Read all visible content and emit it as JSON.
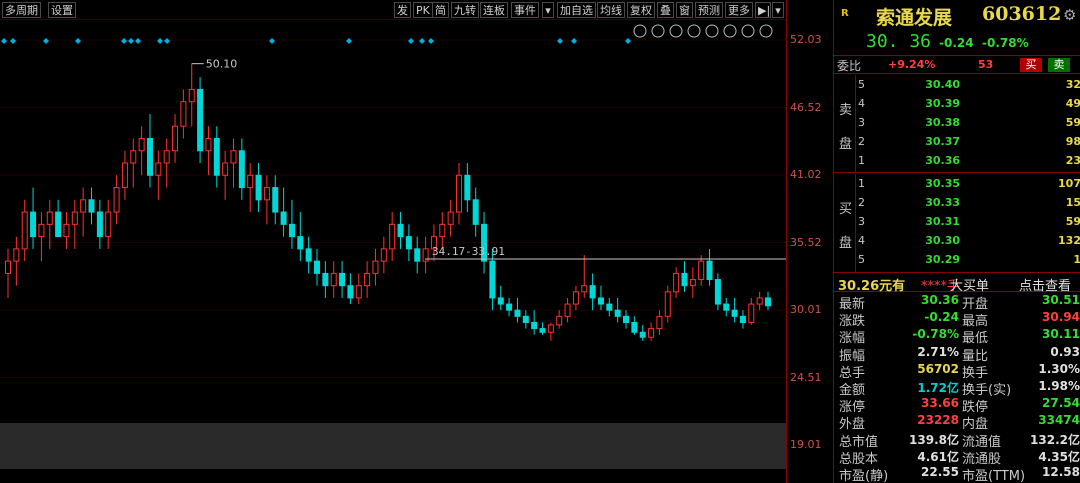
{
  "toolbar": {
    "left": [
      "多周期",
      "设置"
    ],
    "right": [
      "发",
      "PK",
      "简",
      "九转",
      "连板",
      "事件",
      "加自选",
      "均线",
      "复权",
      "叠",
      "窗",
      "预测",
      "更多"
    ]
  },
  "chart_icons": [
    "eye-icon",
    "hand-icon",
    "play-icon",
    "undo-icon",
    "scissors-icon",
    "lock-icon",
    "zoom-in-icon",
    "zoom-out-icon"
  ],
  "y_axis": {
    "ticks": [
      {
        "label": "52.03",
        "value": 52.03
      },
      {
        "label": "46.52",
        "value": 46.52
      },
      {
        "label": "41.02",
        "value": 41.02
      },
      {
        "label": "35.52",
        "value": 35.52
      },
      {
        "label": "30.01",
        "value": 30.01
      },
      {
        "label": "24.51",
        "value": 24.51
      },
      {
        "label": "19.01",
        "value": 19.01
      }
    ]
  },
  "annotations": {
    "high_label": "50.10",
    "range_label": "34.17-33.91"
  },
  "chart_data": {
    "type": "candlestick",
    "ylim": [
      19.01,
      52.03
    ],
    "ohlc": [
      [
        33,
        35,
        31,
        34
      ],
      [
        34,
        36,
        32,
        35
      ],
      [
        35,
        39,
        34,
        38
      ],
      [
        38,
        40,
        35,
        36
      ],
      [
        36,
        38,
        34,
        37
      ],
      [
        37,
        39,
        35,
        38
      ],
      [
        38,
        39,
        36,
        36
      ],
      [
        36,
        38,
        35,
        37
      ],
      [
        37,
        39,
        35,
        38
      ],
      [
        38,
        40,
        36,
        39
      ],
      [
        39,
        40,
        37,
        38
      ],
      [
        38,
        39,
        35,
        36
      ],
      [
        36,
        39,
        35,
        38
      ],
      [
        38,
        41,
        37,
        40
      ],
      [
        40,
        43,
        39,
        42
      ],
      [
        42,
        44,
        40,
        43
      ],
      [
        43,
        45,
        41,
        44
      ],
      [
        44,
        46,
        40,
        41
      ],
      [
        41,
        43,
        39,
        42
      ],
      [
        42,
        44,
        40,
        43
      ],
      [
        43,
        46,
        42,
        45
      ],
      [
        45,
        48,
        44,
        47
      ],
      [
        47,
        50.1,
        45,
        48
      ],
      [
        48,
        49,
        42,
        43
      ],
      [
        43,
        45,
        41,
        44
      ],
      [
        44,
        45,
        40,
        41
      ],
      [
        41,
        43,
        39,
        42
      ],
      [
        42,
        44,
        40,
        43
      ],
      [
        43,
        44,
        39,
        40
      ],
      [
        40,
        42,
        38,
        41
      ],
      [
        41,
        42,
        38,
        39
      ],
      [
        39,
        41,
        37,
        40
      ],
      [
        40,
        41,
        37,
        38
      ],
      [
        38,
        40,
        36,
        37
      ],
      [
        37,
        39,
        35,
        36
      ],
      [
        36,
        38,
        34,
        35
      ],
      [
        35,
        36,
        33,
        34
      ],
      [
        34,
        35,
        32,
        33
      ],
      [
        33,
        34,
        31,
        32
      ],
      [
        32,
        34,
        31,
        33
      ],
      [
        33,
        34,
        31,
        32
      ],
      [
        32,
        33,
        30.5,
        31
      ],
      [
        31,
        33,
        30.5,
        32
      ],
      [
        32,
        34,
        31,
        33
      ],
      [
        33,
        35,
        32,
        34
      ],
      [
        34,
        36,
        33,
        35
      ],
      [
        35,
        38,
        34,
        37
      ],
      [
        37,
        38,
        35,
        36
      ],
      [
        36,
        37,
        34,
        35
      ],
      [
        35,
        36,
        33,
        34
      ],
      [
        34,
        36,
        33,
        35
      ],
      [
        35,
        37,
        34,
        36
      ],
      [
        36,
        38,
        35,
        37
      ],
      [
        37,
        39,
        36,
        38
      ],
      [
        38,
        42,
        37,
        41
      ],
      [
        41,
        42,
        38,
        39
      ],
      [
        39,
        40,
        36,
        37
      ],
      [
        37,
        38,
        33,
        34
      ],
      [
        34,
        35,
        30,
        31
      ],
      [
        31,
        32,
        30,
        30.5
      ],
      [
        30.5,
        31,
        29.5,
        30
      ],
      [
        30,
        31,
        29,
        29.5
      ],
      [
        29.5,
        30,
        28.5,
        29
      ],
      [
        29,
        30,
        28,
        28.5
      ],
      [
        28.5,
        29,
        28,
        28.2
      ],
      [
        28.2,
        29,
        27.5,
        28.8
      ],
      [
        28.8,
        30,
        28.5,
        29.5
      ],
      [
        29.5,
        31,
        29,
        30.5
      ],
      [
        30.5,
        32,
        30,
        31.5
      ],
      [
        31.5,
        34.5,
        31,
        32
      ],
      [
        32,
        33,
        30,
        31
      ],
      [
        31,
        32,
        30,
        30.5
      ],
      [
        30.5,
        31,
        29.5,
        30
      ],
      [
        30,
        31,
        29,
        29.5
      ],
      [
        29.5,
        30,
        28.5,
        29
      ],
      [
        29,
        29.5,
        28,
        28.2
      ],
      [
        28.2,
        28.8,
        27.5,
        27.8
      ],
      [
        27.8,
        29,
        27.5,
        28.5
      ],
      [
        28.5,
        30,
        28,
        29.5
      ],
      [
        29.5,
        32,
        29,
        31.5
      ],
      [
        31.5,
        33.5,
        31,
        33
      ],
      [
        33,
        34,
        31.5,
        32
      ],
      [
        32,
        33.5,
        31,
        32.5
      ],
      [
        32.5,
        34.5,
        32,
        34
      ],
      [
        34,
        35,
        32,
        32.5
      ],
      [
        32.5,
        33,
        30,
        30.5
      ],
      [
        30.5,
        31,
        29.5,
        30
      ],
      [
        30,
        31,
        29,
        29.5
      ],
      [
        29.5,
        30,
        28.5,
        29
      ],
      [
        29,
        31,
        28.8,
        30.5
      ],
      [
        30.5,
        31.5,
        30,
        31
      ],
      [
        31,
        31.5,
        30,
        30.36
      ]
    ]
  },
  "panel": {
    "badge": "R",
    "name": "索通发展",
    "code": "603612",
    "price": "30. 36",
    "change": "-0.24",
    "change_pct": "-0.78%",
    "weibi_label": "委比",
    "weibi_value": "+9.24%",
    "weicha_value": "53",
    "buy_btn": "买",
    "sell_btn": "卖",
    "sell_side_label": [
      "卖",
      "盘"
    ],
    "buy_side_label": [
      "买",
      "盘"
    ],
    "asks": [
      {
        "level": "5",
        "price": "30.40",
        "vol": "32"
      },
      {
        "level": "4",
        "price": "30.39",
        "vol": "49"
      },
      {
        "level": "3",
        "price": "30.38",
        "vol": "59"
      },
      {
        "level": "2",
        "price": "30.37",
        "vol": "98"
      },
      {
        "level": "1",
        "price": "30.36",
        "vol": "23"
      }
    ],
    "bids": [
      {
        "level": "1",
        "price": "30.35",
        "vol": "107"
      },
      {
        "level": "2",
        "price": "30.33",
        "vol": "15"
      },
      {
        "level": "3",
        "price": "30.31",
        "vol": "59"
      },
      {
        "level": "4",
        "price": "30.30",
        "vol": "132"
      },
      {
        "level": "5",
        "price": "30.29",
        "vol": "1"
      }
    ],
    "bigorder": {
      "price": "30.26元有",
      "stars": "****手",
      "label": "大买单",
      "link": "点击查看"
    },
    "stats": [
      {
        "l": "最新",
        "lv": "30.36",
        "lc": "green",
        "r": "开盘",
        "rv": "30.51",
        "rc": "green"
      },
      {
        "l": "涨跌",
        "lv": "-0.24",
        "lc": "green",
        "r": "最高",
        "rv": "30.94",
        "rc": "red"
      },
      {
        "l": "涨幅",
        "lv": "-0.78%",
        "lc": "green",
        "r": "最低",
        "rv": "30.11",
        "rc": "green"
      },
      {
        "l": "振幅",
        "lv": "2.71%",
        "lc": "white",
        "r": "量比",
        "rv": "0.93",
        "rc": "white"
      },
      {
        "l": "总手",
        "lv": "56702",
        "lc": "yellow",
        "r": "换手",
        "rv": "1.30%",
        "rc": "white"
      },
      {
        "l": "金额",
        "lv": "1.72亿",
        "lc": "cyan",
        "r": "换手(实)",
        "rv": "1.98%",
        "rc": "white"
      },
      {
        "l": "涨停",
        "lv": "33.66",
        "lc": "red",
        "r": "跌停",
        "rv": "27.54",
        "rc": "green"
      },
      {
        "l": "外盘",
        "lv": "23228",
        "lc": "red",
        "r": "内盘",
        "rv": "33474",
        "rc": "green"
      },
      {
        "l": "总市值",
        "lv": "139.8亿",
        "lc": "white",
        "r": "流通值",
        "rv": "132.2亿",
        "rc": "white"
      },
      {
        "l": "总股本",
        "lv": "4.61亿",
        "lc": "white",
        "r": "流通股",
        "rv": "4.35亿",
        "rc": "white"
      },
      {
        "l": "市盈(静)",
        "lv": "22.55",
        "lc": "white",
        "r": "市盈(TTM)",
        "rv": "12.58",
        "rc": "white"
      }
    ]
  }
}
